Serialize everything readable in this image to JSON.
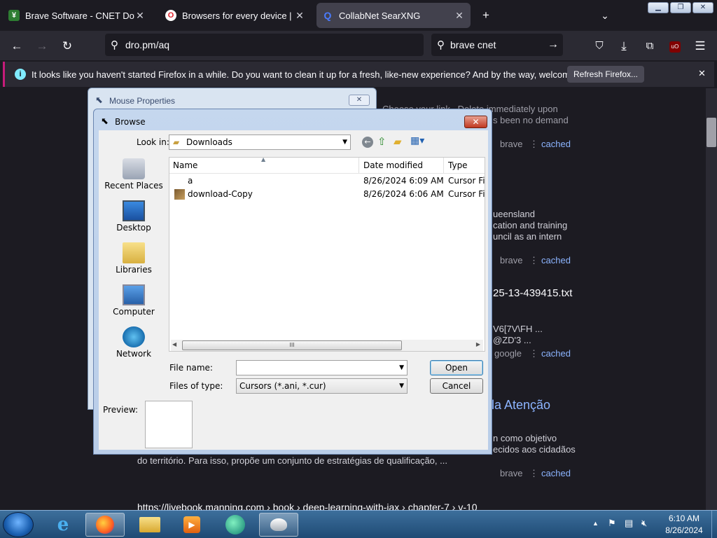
{
  "browser": {
    "tabs": [
      {
        "title": "Brave Software - CNET Downlo",
        "active": false
      },
      {
        "title": "Browsers for every device | Ope",
        "active": false
      },
      {
        "title": "CollabNet SearXNG",
        "active": true
      }
    ],
    "url": "dro.pm/aq",
    "search_query": "brave cnet",
    "notification": "It looks like you haven't started Firefox in a while. Do you want to clean it up for a fresh, like-new experience? And by the way, welcome back!",
    "refresh_label": "Refresh Firefox..."
  },
  "page": {
    "lines": [
      "Choose your link . Delete immediately upon",
      "s been no demand",
      "ueensland",
      "cation and training",
      "uncil as an intern",
      "25-13-439415.txt",
      "V6[7V\\FH ...",
      "@ZD'3 ...",
      "la Atenção",
      "n como objetivo",
      "ecidos aos cidadãos",
      "do território. Para isso, propõe um conjunto de estratégias de qualificação, ...",
      "https://livebook.manning.com › book › deep-learning-with-jax › chapter-7 › v-10"
    ],
    "engine_brave": "brave",
    "engine_google": "google",
    "cached": "cached"
  },
  "mouse_dialog": {
    "title": "Mouse Properties"
  },
  "browse_dialog": {
    "title": "Browse",
    "look_in_label": "Look in:",
    "look_in_value": "Downloads",
    "places": [
      "Recent Places",
      "Desktop",
      "Libraries",
      "Computer",
      "Network"
    ],
    "columns": [
      "Name",
      "Date modified",
      "Type"
    ],
    "files": [
      {
        "name": "a",
        "date": "8/26/2024 6:09 AM",
        "type": "Cursor File"
      },
      {
        "name": "download-Copy",
        "date": "8/26/2024 6:06 AM",
        "type": "Cursor File"
      }
    ],
    "scroll_grip": "III",
    "file_name_label": "File name:",
    "file_name_value": "",
    "files_of_type_label": "Files of type:",
    "files_of_type_value": "Cursors (*.ani, *.cur)",
    "open_label": "Open",
    "cancel_label": "Cancel",
    "preview_label": "Preview:"
  },
  "taskbar": {
    "time": "6:10 AM",
    "date": "8/26/2024"
  }
}
